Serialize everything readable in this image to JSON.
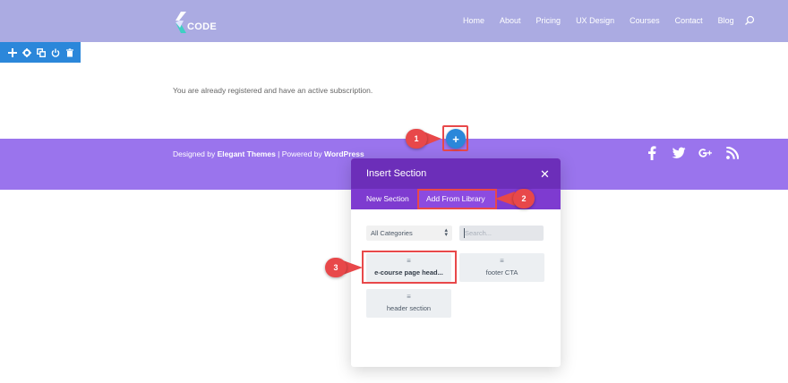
{
  "header": {
    "logo_text": "CODE",
    "nav": [
      "Home",
      "About",
      "Pricing",
      "UX Design",
      "Courses",
      "Contact",
      "Blog"
    ],
    "search_icon": "search-icon"
  },
  "toolbar": {
    "icons": [
      "move-icon",
      "gear-icon",
      "duplicate-icon",
      "power-icon",
      "trash-icon"
    ]
  },
  "content": {
    "message": "You are already registered and have an active subscription."
  },
  "footer": {
    "prefix": "Designed by ",
    "brand": "Elegant Themes",
    "middle": " | Powered by ",
    "platform": "WordPress",
    "social": [
      "facebook-icon",
      "twitter-icon",
      "google-plus-icon",
      "rss-icon"
    ]
  },
  "add_button": {
    "label": "+"
  },
  "markers": [
    "1",
    "2",
    "3"
  ],
  "modal": {
    "title": "Insert Section",
    "close": "✕",
    "tabs": [
      "New Section",
      "Add From Library"
    ],
    "category_select": "All Categories",
    "search_placeholder": "Search...",
    "items": [
      {
        "label": "e-course page head..."
      },
      {
        "label": "footer CTA"
      },
      {
        "label": "header section"
      }
    ],
    "item_glyph": "≡"
  },
  "colors": {
    "header_bg": "#ababe2",
    "footer_bg": "#9a74ed",
    "modal_header": "#6c2eb9",
    "modal_tabs": "#7e3bd0",
    "accent_blue": "#2b87da",
    "callout_red": "#e8484a"
  }
}
